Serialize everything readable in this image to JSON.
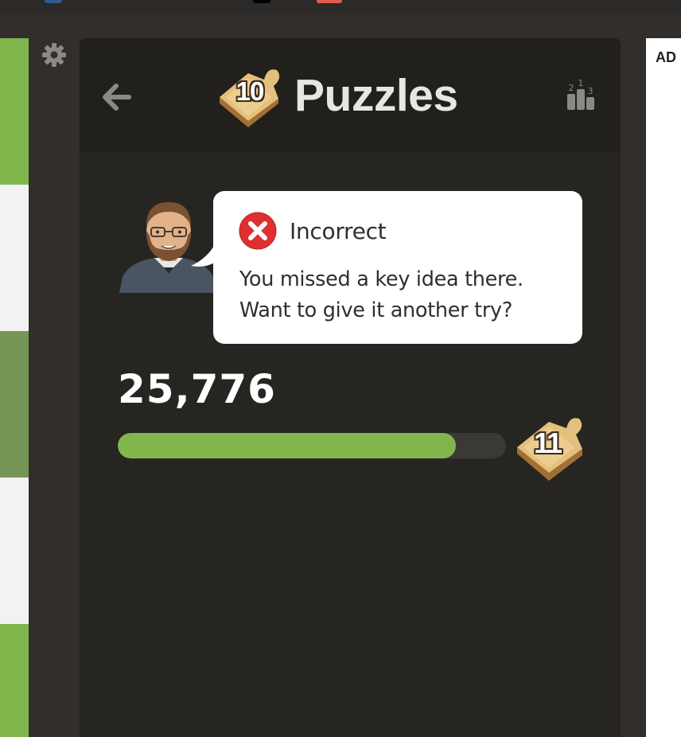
{
  "header": {
    "title": "Puzzles",
    "level_badge": "10",
    "back_icon": "arrow-left-icon",
    "leaderboard_icon": "leaderboard-podium-icon",
    "podium_ranks": [
      "2",
      "1",
      "3"
    ]
  },
  "settings": {
    "icon": "gear-icon"
  },
  "feedback": {
    "status_icon": "x-circle-icon",
    "title": "Incorrect",
    "message": "You missed a key idea there. Want to give it another try?"
  },
  "progress": {
    "score": "25,776",
    "fill_percent": 87,
    "next_level": "11"
  },
  "ad": {
    "label": "AD"
  },
  "colors": {
    "accent_green": "#81b64c",
    "error_red": "#e02f2f",
    "panel_bg": "#262522",
    "header_bg": "#21201d",
    "title_text": "#e6e6e5"
  }
}
